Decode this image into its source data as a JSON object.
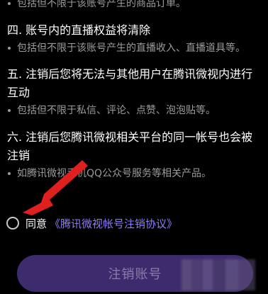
{
  "sections": [
    {
      "heading": "",
      "bullet": "包括但不限于该账号产生的商品订单。"
    },
    {
      "heading": "四. 账号内的直播权益将清除",
      "bullet": "包括但不限于该账号产生的直播收入、直播道具等。"
    },
    {
      "heading": "五. 注销后您将无法与其他用户在腾讯微视内进行互动",
      "bullet": "包括但不限于私信、评论、点赞、泡泡贴等。"
    },
    {
      "heading": "六. 注销后您腾讯微视相关平台的同一帐号也会被注销",
      "bullet": "如腾讯微视手机QQ公众号服务等相关产品。"
    }
  ],
  "agreement": {
    "prefix": "同意",
    "link": "《腾讯微视帐号注销协议》"
  },
  "cta": {
    "label": "注销账号"
  },
  "colors": {
    "background": "#000000",
    "heading": "#ffffff",
    "bullet": "#9c9c9c",
    "link": "#8f7bff",
    "button": "#3e2b6e",
    "button_text": "#8a7ca8",
    "annotation_arrow": "#e01f1f"
  },
  "icons": {
    "radio": "radio-unchecked-icon",
    "annotation": "red-arrow-annotation"
  }
}
